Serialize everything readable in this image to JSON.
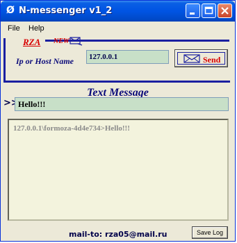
{
  "window": {
    "title": "N-messenger v1_2",
    "app_icon": "Ø"
  },
  "menu": [
    "File",
    "Help"
  ],
  "branding": {
    "logo": "RZA",
    "new_badge": "NEW"
  },
  "host": {
    "label": "Ip or Host Name",
    "value": "127.0.0.1"
  },
  "send_button": {
    "label": "Send"
  },
  "message": {
    "section_title": "Text Message",
    "prompt": ">>",
    "value": "Hello!!!"
  },
  "log": {
    "lines": [
      "127.0.0.1\\formoza-4d4e734>Hello!!!"
    ]
  },
  "footer": {
    "mailto": "mail-to: rza05@mail.ru",
    "save_log_label": "Save Log"
  },
  "colors": {
    "title_bar": "#0054e3",
    "accent_red": "#d80000",
    "navy": "#1a1fa0",
    "field_bg": "#c8e0c8",
    "log_bg": "#f3f3dd"
  }
}
